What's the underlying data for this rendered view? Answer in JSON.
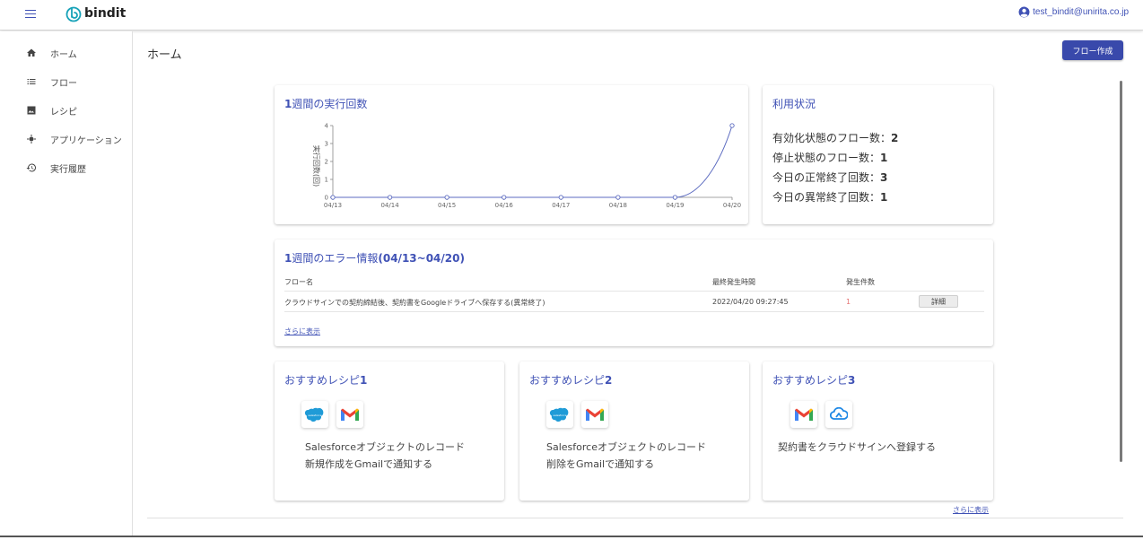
{
  "header": {
    "brand": "bindit",
    "user_email": "test_bindit@unirita.co.jp"
  },
  "sidebar": {
    "items": [
      {
        "label": "ホーム",
        "icon": "home-icon"
      },
      {
        "label": "フロー",
        "icon": "list-icon"
      },
      {
        "label": "レシピ",
        "icon": "image-icon"
      },
      {
        "label": "アプリケーション",
        "icon": "app-icon"
      },
      {
        "label": "実行履歴",
        "icon": "history-icon"
      }
    ]
  },
  "main": {
    "title": "ホーム",
    "create_button": "フロー作成"
  },
  "weekly_runs": {
    "title_num": "1",
    "title_text": "週間の実行回数"
  },
  "chart_data": {
    "type": "line",
    "title": "1週間の実行回数",
    "ylabel": "実行回数(回)",
    "categories": [
      "04/13",
      "04/14",
      "04/15",
      "04/16",
      "04/17",
      "04/18",
      "04/19",
      "04/20"
    ],
    "values": [
      0,
      0,
      0,
      0,
      0,
      0,
      0,
      4
    ],
    "yticks": [
      "0",
      "1",
      "2",
      "3",
      "4"
    ],
    "ylim": [
      0,
      4
    ],
    "color": "#5c6bc0"
  },
  "usage": {
    "title": "利用状況",
    "rows": [
      {
        "label": "有効化状態のフロー数：",
        "value": "2"
      },
      {
        "label": "停止状態のフロー数：",
        "value": "1"
      },
      {
        "label": "今日の正常終了回数：",
        "value": "3"
      },
      {
        "label": "今日の異常終了回数：",
        "value": "1"
      }
    ]
  },
  "errors": {
    "title_num": "1",
    "title_text": "週間のエラー情報",
    "title_range": "(04/13~04/20)",
    "columns": {
      "flow": "フロー名",
      "time": "最終発生時間",
      "count": "発生件数"
    },
    "rows": [
      {
        "flow": "クラウドサインでの契約締結後、契約書をGoogleドライブへ保存する(異常終了)",
        "time": "2022/04/20 09:27:45",
        "count": "1",
        "detail": "詳細"
      }
    ],
    "more": "さらに表示"
  },
  "recipes": [
    {
      "title_text": "おすすめレシピ",
      "title_num": "1",
      "icons": [
        "salesforce-icon",
        "gmail-icon"
      ],
      "line1": "Salesforceオブジェクトのレコード",
      "line2": "新規作成をGmailで通知する"
    },
    {
      "title_text": "おすすめレシピ",
      "title_num": "2",
      "icons": [
        "salesforce-icon",
        "gmail-icon"
      ],
      "line1": "Salesforceオブジェクトのレコード",
      "line2": "削除をGmailで通知する"
    },
    {
      "title_text": "おすすめレシピ",
      "title_num": "3",
      "icons": [
        "gmail-icon",
        "cloudsign-icon"
      ],
      "line1": "契約書をクラウドサインへ登録する",
      "line2": ""
    }
  ],
  "recipes_more": "さらに表示",
  "colors": {
    "accent": "#3f51b5",
    "button": "#3949ab",
    "error_count": "#e57373"
  }
}
